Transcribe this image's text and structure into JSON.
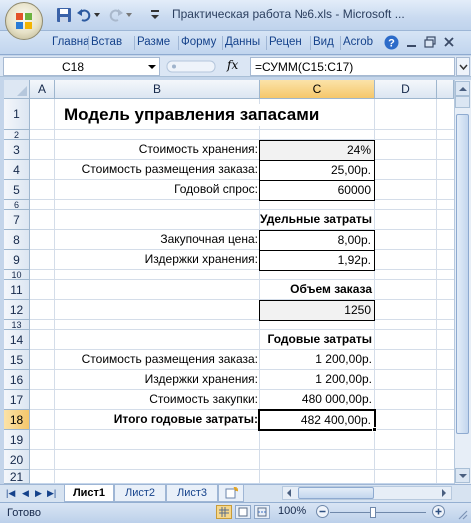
{
  "window": {
    "title": "Практическая работа №6.xls - Microsoft ..."
  },
  "ribbon": {
    "tabs": [
      "Главна",
      "Встав",
      "Разме",
      "Форму",
      "Данны",
      "Рецен",
      "Вид",
      "Acrob"
    ]
  },
  "formula_bar": {
    "name_box": "C18",
    "fx_label": "fx",
    "formula": "=СУММ(C15:C17)"
  },
  "columns": [
    "A",
    "B",
    "C",
    "D"
  ],
  "selected_column": "C",
  "selected_row": "18",
  "rows": [
    "1",
    "2",
    "3",
    "4",
    "5",
    "6",
    "7",
    "8",
    "9",
    "10",
    "11",
    "12",
    "13",
    "14",
    "15",
    "16",
    "17",
    "18",
    "19",
    "20",
    "21"
  ],
  "sheet": {
    "title": "Модель управления запасами",
    "storage_cost_label": "Стоимость хранения:",
    "storage_cost_value": "24%",
    "order_cost_label": "Стоимость размещения заказа:",
    "order_cost_value": "25,00р.",
    "annual_demand_label": "Годовой спрос:",
    "annual_demand_value": "60000",
    "unit_costs_header": "Удельные затраты",
    "purchase_price_label": "Закупочная цена:",
    "purchase_price_value": "8,00р.",
    "holding_cost_label": "Издержки хранения:",
    "holding_cost_value": "1,92р.",
    "order_size_header": "Объем заказа",
    "order_size_value": "1250",
    "annual_costs_header": "Годовые затраты",
    "annual_order_cost_label": "Стоимость размещения заказа:",
    "annual_order_cost_value": "1 200,00р.",
    "annual_holding_label": "Издержки хранения:",
    "annual_holding_value": "1 200,00р.",
    "purchase_cost_label": "Стоимость закупки:",
    "purchase_cost_value": "480 000,00р.",
    "total_label": "Итого годовые затраты:",
    "total_value": "482 400,00р."
  },
  "sheet_tabs": [
    "Лист1",
    "Лист2",
    "Лист3"
  ],
  "active_sheet": "Лист1",
  "status": {
    "ready": "Готово",
    "zoom": "100%"
  },
  "colors": {
    "accent": "#15428b",
    "selection": "#f5c76b"
  }
}
